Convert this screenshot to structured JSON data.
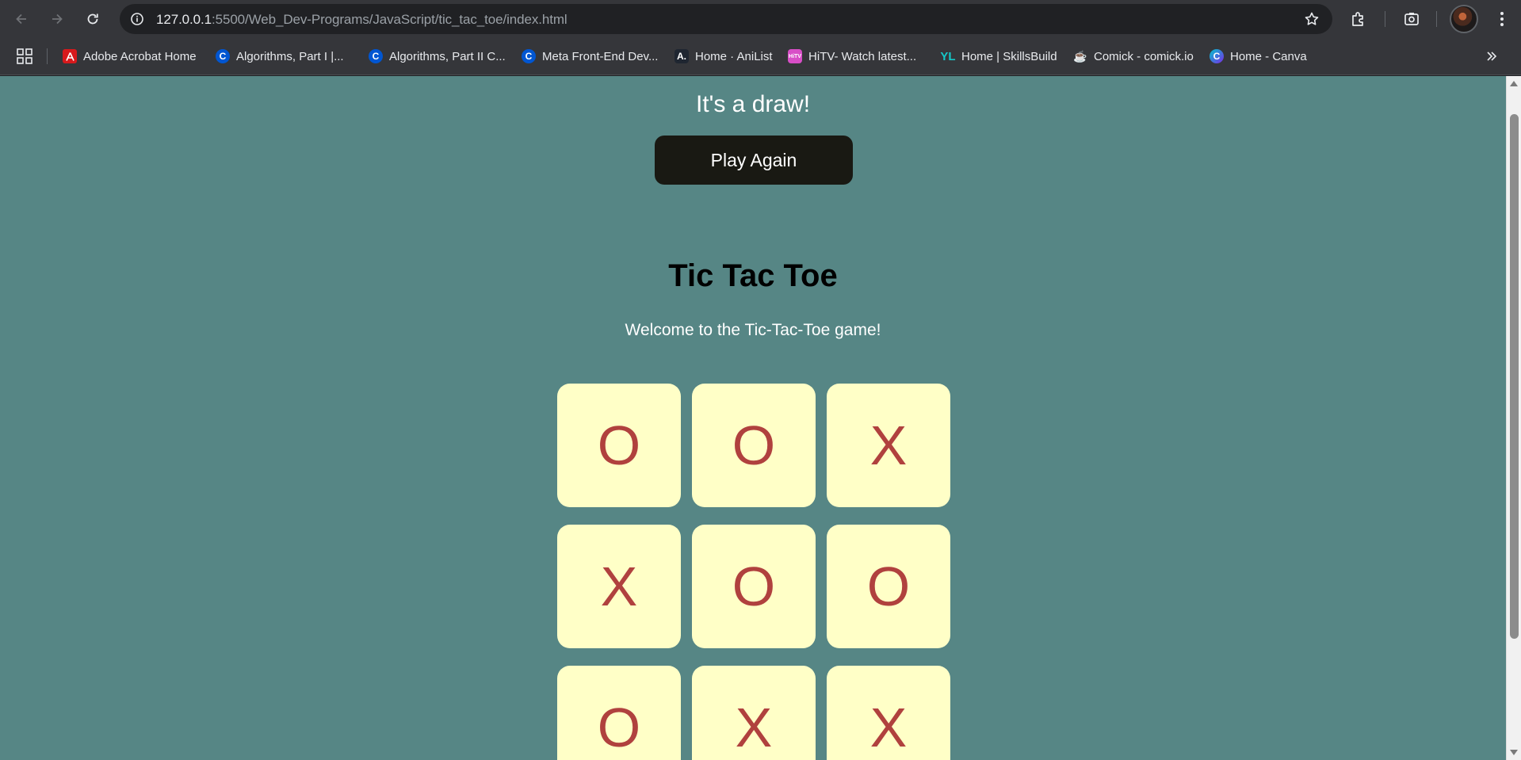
{
  "browser": {
    "url_host": "127.0.0.1",
    "url_rest": ":5500/Web_Dev-Programs/JavaScript/tic_tac_toe/index.html",
    "bookmarks": [
      {
        "label": "Adobe Acrobat Home",
        "icon": "acrobat-icon",
        "glyph": "A"
      },
      {
        "label": "Algorithms, Part I |...",
        "icon": "coursera-icon",
        "glyph": "C"
      },
      {
        "label": "Algorithms, Part II C...",
        "icon": "coursera-icon",
        "glyph": "C"
      },
      {
        "label": "Meta Front-End Dev...",
        "icon": "coursera-icon",
        "glyph": "C"
      },
      {
        "label": "Home · AniList",
        "icon": "anilist-icon",
        "glyph": "A."
      },
      {
        "label": "HiTV- Watch latest...",
        "icon": "hitv-icon",
        "glyph": "HiTV"
      },
      {
        "label": "Home | SkillsBuild",
        "icon": "skillsbuild-icon",
        "glyph": "YL"
      },
      {
        "label": "Comick - comick.io",
        "icon": "comick-icon",
        "glyph": "☕"
      },
      {
        "label": "Home - Canva",
        "icon": "canva-icon",
        "glyph": "C"
      }
    ]
  },
  "page": {
    "result_message": "It's a draw!",
    "play_again_label": "Play Again",
    "title": "Tic Tac Toe",
    "welcome": "Welcome to the Tic-Tac-Toe game!",
    "board": [
      "O",
      "O",
      "X",
      "X",
      "O",
      "O",
      "O",
      "X",
      "X"
    ]
  },
  "colors": {
    "page_background": "#568685",
    "cell_background": "#ffffc7",
    "mark_color": "#b0413e",
    "button_background": "#191913"
  }
}
